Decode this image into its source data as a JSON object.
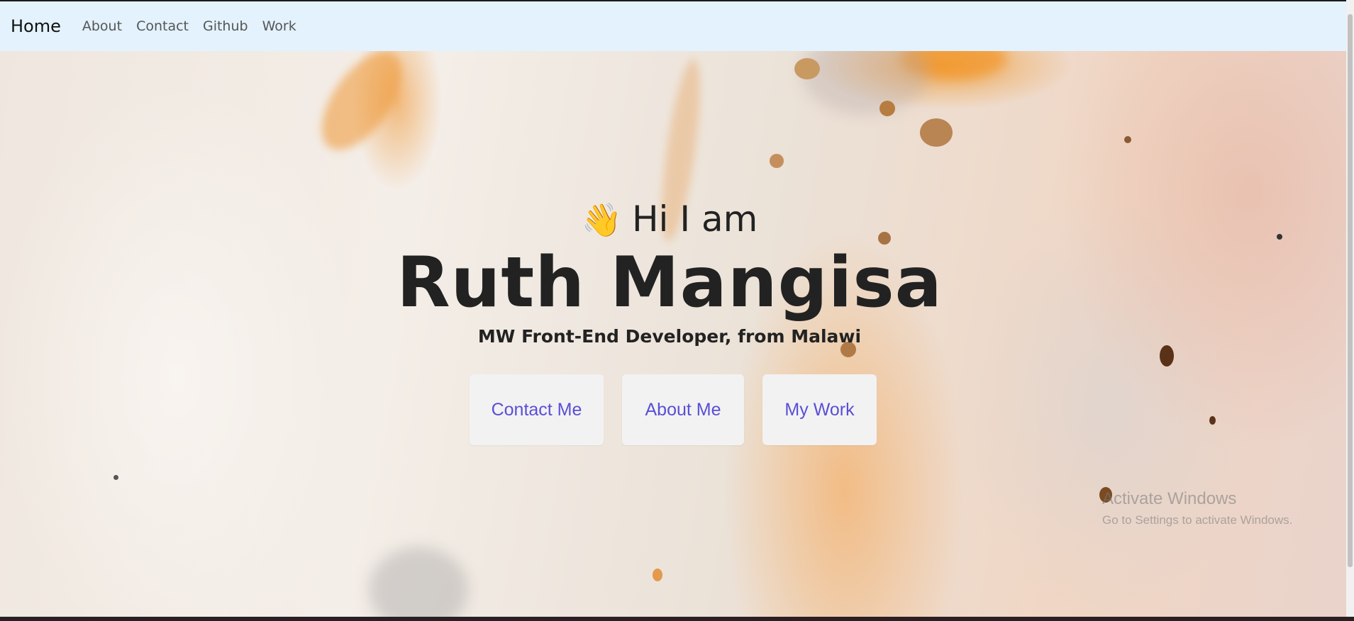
{
  "nav": {
    "brand": "Home",
    "links": [
      "About",
      "Contact",
      "Github",
      "Work"
    ]
  },
  "hero": {
    "wave_emoji": "👋",
    "greeting": "Hi I am",
    "name": "Ruth Mangisa",
    "tagline": "MW Front-End Developer, from Malawi",
    "buttons": [
      "Contact Me",
      "About Me",
      "My Work"
    ]
  },
  "watermark": {
    "title": "Activate Windows",
    "subtitle": "Go to Settings to activate Windows."
  },
  "colors": {
    "navbar_bg": "#e3f2fd",
    "button_text": "#5a4fd6",
    "button_bg": "#f2f2f2",
    "heading_text": "#222222"
  }
}
